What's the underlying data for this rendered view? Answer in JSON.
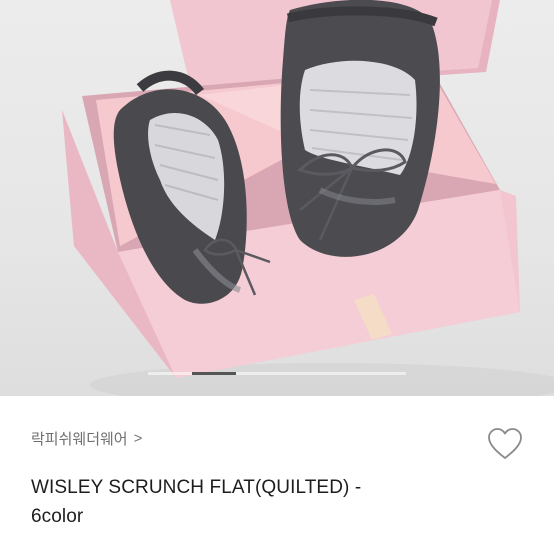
{
  "product": {
    "brand_link": "락피쉬웨더웨어",
    "brand_chevron": ">",
    "title_line1": "WISLEY SCRUNCH FLAT(QUILTED) -",
    "title_line2": "6color"
  },
  "carousel": {
    "current_index": 1,
    "progress_fraction": 0.17
  },
  "icons": {
    "wishlist": "heart-outline-icon",
    "chevron": "chevron-right-icon"
  },
  "colors": {
    "box_pink": "#f3cdd6",
    "shoe_gray": "#4a4a4e",
    "title_text": "#1d1d1d",
    "brand_text": "#6f6f6f"
  }
}
